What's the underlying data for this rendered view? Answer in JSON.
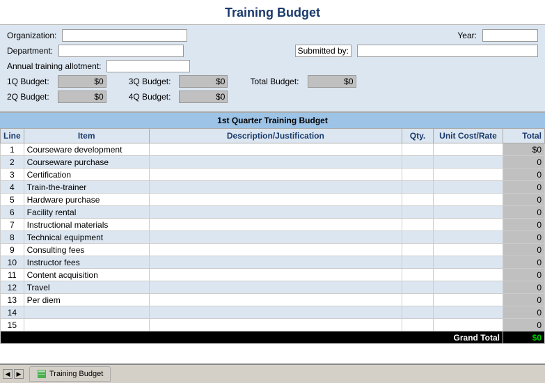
{
  "title": "Training Budget",
  "form": {
    "organization_label": "Organization:",
    "year_label": "Year:",
    "department_label": "Department:",
    "submitted_by_label": "Submitted by:",
    "annual_label": "Annual training allotment:",
    "org_value": "",
    "year_value": "",
    "dept_value": "",
    "submitted_value": "",
    "annual_value": ""
  },
  "budgets": {
    "q1_label": "1Q Budget:",
    "q1_value": "$0",
    "q2_label": "2Q Budget:",
    "q2_value": "$0",
    "q3_label": "3Q Budget:",
    "q3_value": "$0",
    "q4_label": "4Q Budget:",
    "q4_value": "$0",
    "total_label": "Total Budget:",
    "total_value": "$0"
  },
  "section_title": "1st Quarter Training Budget",
  "table": {
    "headers": [
      "Line",
      "Item",
      "Description/Justification",
      "Qty.",
      "Unit Cost/Rate",
      "Total"
    ],
    "rows": [
      {
        "line": "1",
        "item": "Courseware development",
        "desc": "",
        "qty": "",
        "rate": "",
        "total": "$0"
      },
      {
        "line": "2",
        "item": "Courseware purchase",
        "desc": "",
        "qty": "",
        "rate": "",
        "total": "0"
      },
      {
        "line": "3",
        "item": "Certification",
        "desc": "",
        "qty": "",
        "rate": "",
        "total": "0"
      },
      {
        "line": "4",
        "item": "Train-the-trainer",
        "desc": "",
        "qty": "",
        "rate": "",
        "total": "0"
      },
      {
        "line": "5",
        "item": "Hardware purchase",
        "desc": "",
        "qty": "",
        "rate": "",
        "total": "0"
      },
      {
        "line": "6",
        "item": "Facility rental",
        "desc": "",
        "qty": "",
        "rate": "",
        "total": "0"
      },
      {
        "line": "7",
        "item": "Instructional materials",
        "desc": "",
        "qty": "",
        "rate": "",
        "total": "0"
      },
      {
        "line": "8",
        "item": "Technical equipment",
        "desc": "",
        "qty": "",
        "rate": "",
        "total": "0"
      },
      {
        "line": "9",
        "item": "Consulting fees",
        "desc": "",
        "qty": "",
        "rate": "",
        "total": "0"
      },
      {
        "line": "10",
        "item": "Instructor fees",
        "desc": "",
        "qty": "",
        "rate": "",
        "total": "0"
      },
      {
        "line": "11",
        "item": "Content acquisition",
        "desc": "",
        "qty": "",
        "rate": "",
        "total": "0"
      },
      {
        "line": "12",
        "item": "Travel",
        "desc": "",
        "qty": "",
        "rate": "",
        "total": "0"
      },
      {
        "line": "13",
        "item": "Per diem",
        "desc": "",
        "qty": "",
        "rate": "",
        "total": "0"
      },
      {
        "line": "14",
        "item": "",
        "desc": "",
        "qty": "",
        "rate": "",
        "total": "0"
      },
      {
        "line": "15",
        "item": "",
        "desc": "",
        "qty": "",
        "rate": "",
        "total": "0"
      }
    ],
    "grand_total_label": "Grand Total",
    "grand_total_value": "$0"
  },
  "taskbar": {
    "tab_label": "Training Budget"
  }
}
